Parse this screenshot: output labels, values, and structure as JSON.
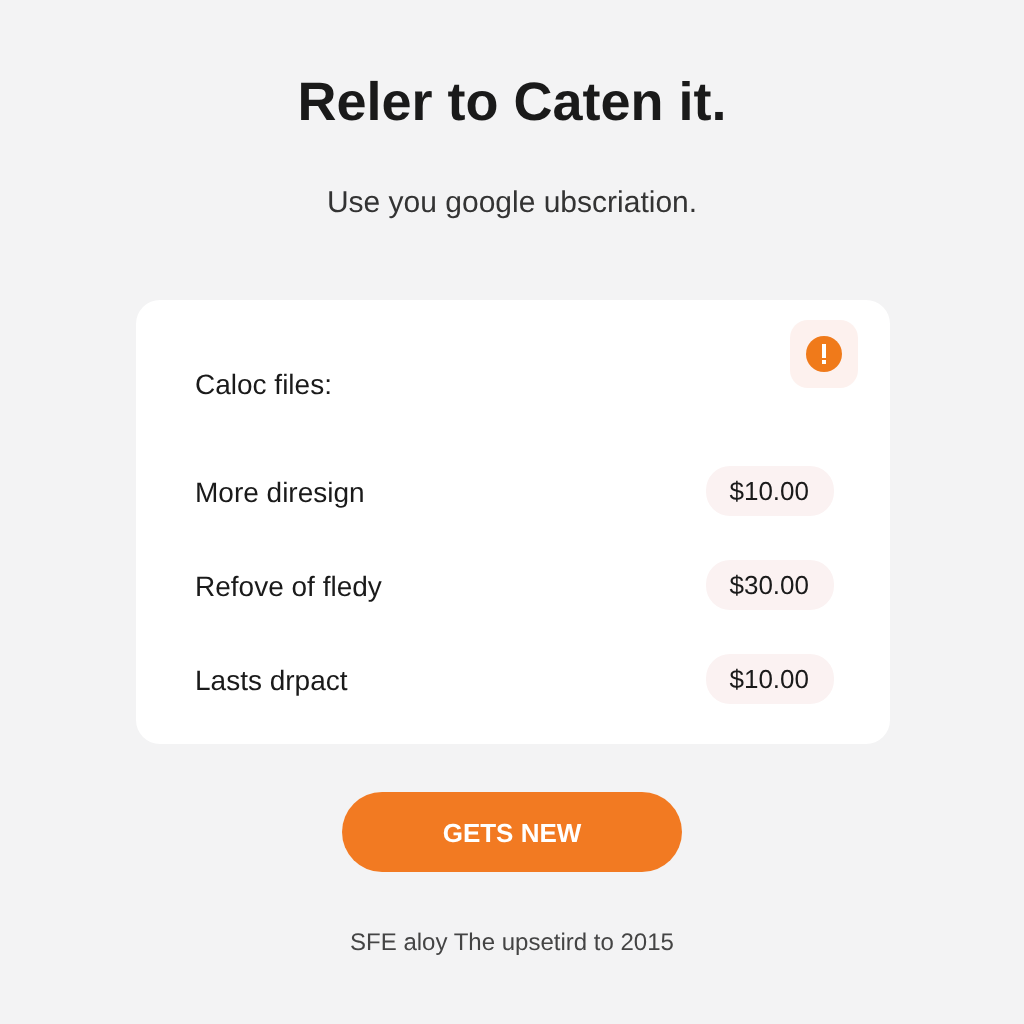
{
  "title": "Reler to Caten it.",
  "subtitle": "Use you google ubscriation.",
  "card": {
    "heading": "Caloc files:",
    "items": [
      {
        "label": "More diresign",
        "price": "$10.00"
      },
      {
        "label": "Refove of fledy",
        "price": "$30.00"
      },
      {
        "label": "Lasts drpact",
        "price": "$10.00"
      }
    ]
  },
  "button": "GETS NEW",
  "footer": "SFE aloy The upsetird to 2015"
}
